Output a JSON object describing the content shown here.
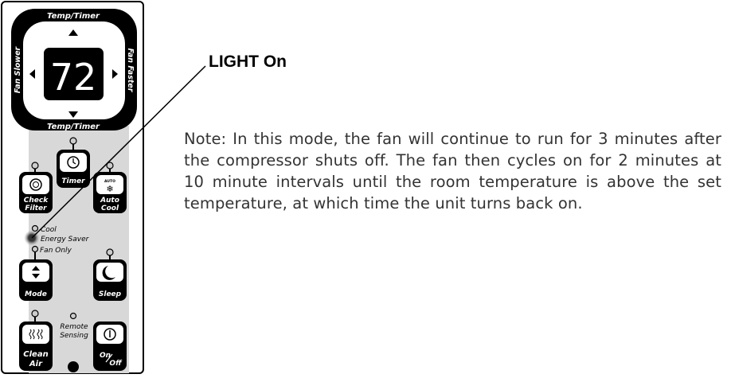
{
  "panel": {
    "top_label": "Temp/Timer",
    "bottom_label": "Temp/Timer",
    "left_label": "Fan Slower",
    "right_label": "Fan Faster",
    "display_value": "72",
    "buttons": {
      "timer": "Timer",
      "check_filter_1": "Check",
      "check_filter_2": "Filter",
      "auto_cool_1": "Auto",
      "auto_cool_2": "Cool",
      "auto_badge": "AUTO",
      "mode": "Mode",
      "sleep": "Sleep",
      "clean_air_1": "Clean",
      "clean_air_2": "Air",
      "on_off_1": "On",
      "on_off_2": "Off"
    },
    "mode_labels": {
      "cool": "Cool",
      "energy_saver": "Energy Saver",
      "fan_only": "Fan Only"
    },
    "remote_sensing_1": "Remote",
    "remote_sensing_2": "Sensing"
  },
  "callout": {
    "label": "LIGHT On"
  },
  "note": "Note: In this mode, the fan will continue to run for 3 minutes after the compressor shuts off. The fan then cycles on for 2 minutes at 10 minute intervals until the room temperature is above the set temperature, at which time the unit turns back on."
}
